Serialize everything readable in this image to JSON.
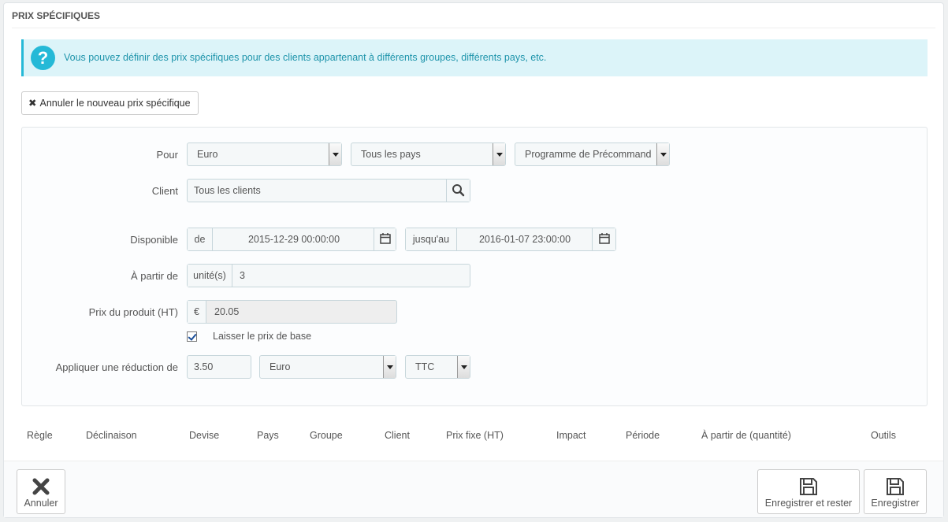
{
  "panel": {
    "title": "PRIX SPÉCIFIQUES"
  },
  "alert": {
    "icon": "?",
    "text": "Vous pouvez définir des prix spécifiques pour des clients appartenant à différents groupes, différents pays, etc."
  },
  "cancel_new_button": {
    "icon": "close-icon",
    "label": "Annuler le nouveau prix spécifique"
  },
  "form": {
    "pour": {
      "label": "Pour",
      "currency": "Euro",
      "country": "Tous les pays",
      "group": "Programme de Précommande"
    },
    "client": {
      "label": "Client",
      "value": "Tous les clients",
      "icon": "search-icon"
    },
    "disponible": {
      "label": "Disponible",
      "from_addon": "de",
      "from_value": "2015-12-29 00:00:00",
      "to_addon": "jusqu'au",
      "to_value": "2016-01-07 23:00:00",
      "icon": "calendar-icon"
    },
    "a_partir_de": {
      "label": "À partir de",
      "addon": "unité(s)",
      "value": "3"
    },
    "prix_produit": {
      "label": "Prix du produit (HT)",
      "addon": "€",
      "value": "20.05"
    },
    "laisser_prix": {
      "label": "Laisser le prix de base",
      "checked": true
    },
    "reduction": {
      "label": "Appliquer une réduction de",
      "value": "3.50",
      "type": "Euro",
      "tax": "TTC"
    }
  },
  "table": {
    "columns": [
      "Règle",
      "Déclinaison",
      "Devise",
      "Pays",
      "Groupe",
      "Client",
      "Prix fixe (HT)",
      "Impact",
      "Période",
      "À partir de (quantité)",
      "Outils"
    ]
  },
  "footer": {
    "cancel": {
      "label": "Annuler",
      "icon": "close-icon"
    },
    "save_stay": {
      "label": "Enregistrer et rester",
      "icon": "save-icon"
    },
    "save": {
      "label": "Enregistrer",
      "icon": "save-icon"
    }
  },
  "colors": {
    "accent": "#25b9d7",
    "alert_bg": "#dcf4f9",
    "alert_text": "#1e94ab"
  }
}
